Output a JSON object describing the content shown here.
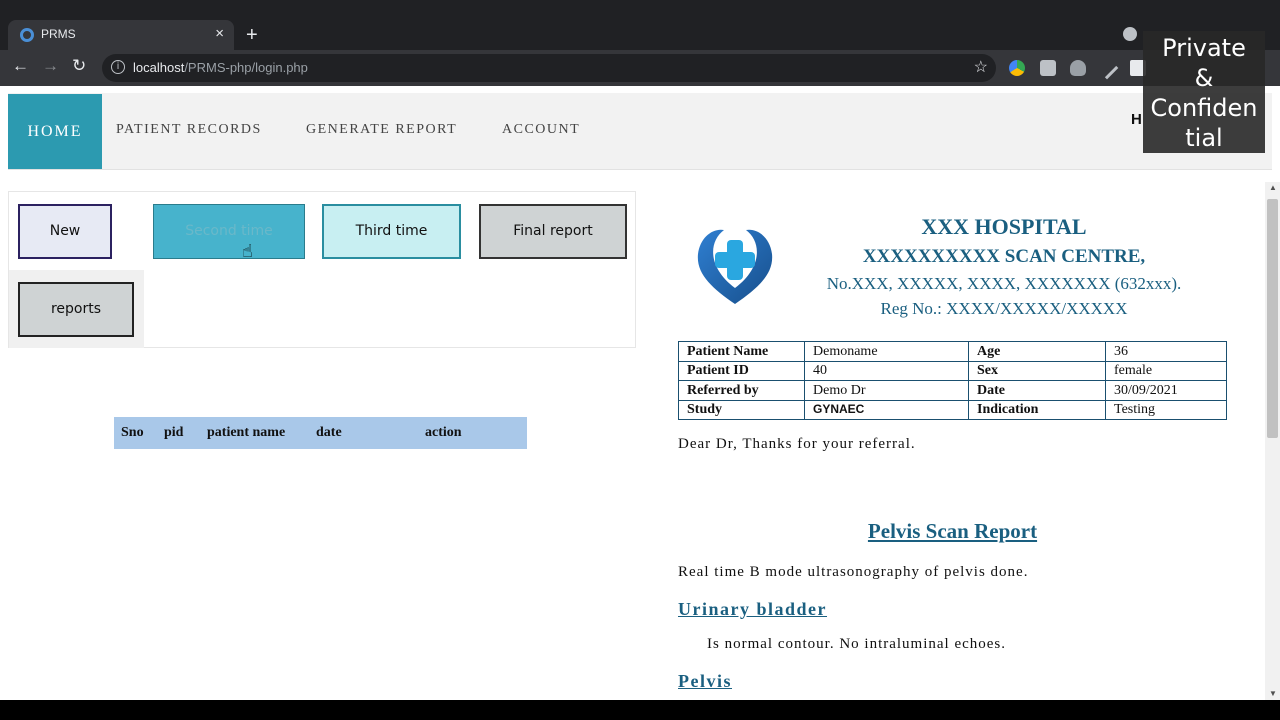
{
  "browser": {
    "tab_title": "PRMS",
    "tab_close": "×",
    "new_tab": "+",
    "url_host": "localhost",
    "url_path": "/PRMS-php/login.php",
    "nav": {
      "back": "←",
      "forward": "→",
      "reload": "↻"
    },
    "info_glyph": "i",
    "star": "☆"
  },
  "navbar": {
    "home": "HOME",
    "links": [
      "PATIENT RECORDS",
      "GENERATE REPORT",
      "ACCOUNT"
    ],
    "right_text": "H"
  },
  "overlay": {
    "line1": "Private",
    "line2": "&",
    "line3": "Confiden",
    "line4": "tial"
  },
  "buttons": {
    "new": "New",
    "second": "Second time",
    "third": "Third time",
    "final": "Final report",
    "reports": "reports"
  },
  "records_table": {
    "headers": [
      "Sno",
      "pid",
      "patient name",
      "date",
      "action"
    ]
  },
  "report": {
    "hospital_name": "XXX HOSPITAL",
    "centre": "XXXXXXXXXX SCAN CENTRE,",
    "address": "No.XXX, XXXXX, XXXX, XXXXXXX (632xxx).",
    "reg_no": "Reg No.: XXXX/XXXXX/XXXXX",
    "patient": {
      "name_label": "Patient Name",
      "name": "Demoname",
      "age_label": "Age",
      "age": "36",
      "id_label": "Patient ID",
      "id": "40",
      "sex_label": "Sex",
      "sex": "female",
      "ref_label": "Referred by",
      "ref": "Demo Dr",
      "date_label": "Date",
      "date": "30/09/2021",
      "study_label": "Study",
      "study": "GYNAEC",
      "ind_label": "Indication",
      "indication": "Testing"
    },
    "greeting": "Dear Dr, Thanks for your referral.",
    "title": "Pelvis Scan Report",
    "intro": "Real time B mode ultrasonography of pelvis done.",
    "sec1_title": "Urinary bladder",
    "sec1_text": "Is normal contour. No intraluminal echoes.",
    "sec2_title": "Pelvis"
  },
  "colors": {
    "accent": "#2c9ab0",
    "report_heading": "#1a5f80",
    "table_header_bg": "#a9c8e9"
  }
}
